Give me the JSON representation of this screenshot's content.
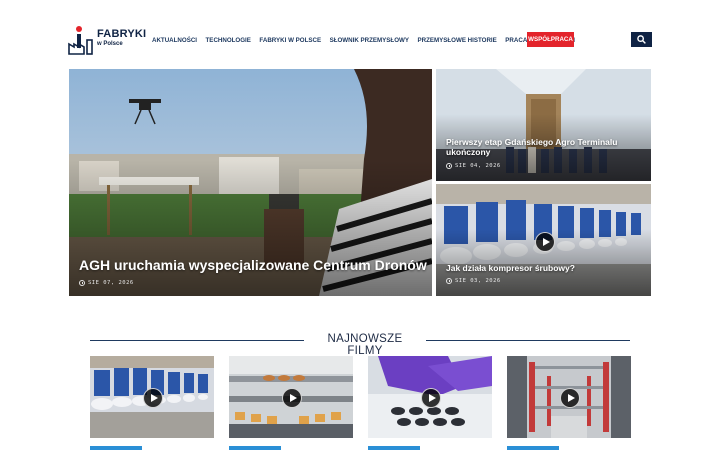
{
  "brand": {
    "name": "FABRYKI",
    "sub": "w Polsce",
    "accent": "#0f2344",
    "red": "#e3242b"
  },
  "nav": {
    "items": [
      "AKTUALNOŚCI",
      "TECHNOLOGIE",
      "FABRYKI W POLSCE",
      "SŁOWNIK PRZEMYSŁOWY",
      "PRZEMYSŁOWE HISTORIE",
      "PRACA W FABRYKACH"
    ],
    "cta": "WSPÓŁPRACA",
    "search_icon": "search-icon"
  },
  "hero": {
    "main": {
      "title": "AGH uruchamia wyspecjalizowane Centrum Dronów",
      "date": "SIE 07, 2026"
    },
    "side1": {
      "title": "Pierwszy etap Gdańskiego Agro Terminalu ukończony",
      "date": "SIE 04, 2026"
    },
    "side2": {
      "title": "Jak działa kompresor śrubowy?",
      "date": "SIE 03, 2026"
    }
  },
  "videos": {
    "heading": "NAJNOWSZE FILMY",
    "play_icon": "play-icon"
  }
}
